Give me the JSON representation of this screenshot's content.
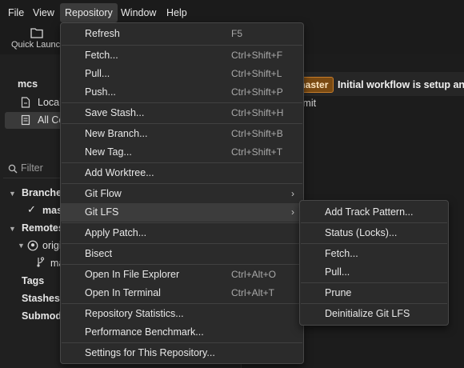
{
  "menubar": {
    "items": [
      "File",
      "View",
      "Repository",
      "Window",
      "Help"
    ]
  },
  "toolbar": {
    "quick_launch": "Quick Launch"
  },
  "sidebar": {
    "repo_name": "mcs",
    "local_changes": "Local Changes",
    "all_commits": "All Commits",
    "filter_placeholder": "Filter",
    "branches": "Branches",
    "master": "master",
    "remotes": "Remotes",
    "origin": "origin",
    "origin_master": "master",
    "tags": "Tags",
    "stashes": "Stashes",
    "submodules": "Submodules"
  },
  "commit": {
    "badge": "master",
    "title": "Initial workflow is setup and",
    "subtitle": "mmit"
  },
  "menu": {
    "items": [
      {
        "label": "Refresh",
        "shortcut": "F5"
      },
      {
        "label": "Fetch...",
        "shortcut": "Ctrl+Shift+F"
      },
      {
        "label": "Pull...",
        "shortcut": "Ctrl+Shift+L"
      },
      {
        "label": "Push...",
        "shortcut": "Ctrl+Shift+P"
      },
      {
        "label": "Save Stash...",
        "shortcut": "Ctrl+Shift+H"
      },
      {
        "label": "New Branch...",
        "shortcut": "Ctrl+Shift+B"
      },
      {
        "label": "New Tag...",
        "shortcut": "Ctrl+Shift+T"
      },
      {
        "label": "Add Worktree...",
        "shortcut": ""
      },
      {
        "label": "Git Flow",
        "shortcut": ""
      },
      {
        "label": "Git LFS",
        "shortcut": ""
      },
      {
        "label": "Apply Patch...",
        "shortcut": ""
      },
      {
        "label": "Bisect",
        "shortcut": ""
      },
      {
        "label": "Open In File Explorer",
        "shortcut": "Ctrl+Alt+O"
      },
      {
        "label": "Open In Terminal",
        "shortcut": "Ctrl+Alt+T"
      },
      {
        "label": "Repository Statistics...",
        "shortcut": ""
      },
      {
        "label": "Performance Benchmark...",
        "shortcut": ""
      },
      {
        "label": "Settings for This Repository...",
        "shortcut": ""
      }
    ]
  },
  "submenu": {
    "items": [
      {
        "label": "Add Track Pattern..."
      },
      {
        "label": "Status (Locks)..."
      },
      {
        "label": "Fetch..."
      },
      {
        "label": "Pull..."
      },
      {
        "label": "Prune"
      },
      {
        "label": "Deinitialize Git LFS"
      }
    ]
  },
  "colors": {
    "accent_badge": "#7a4a12",
    "badge_border": "#c77d2a",
    "menu_bg": "#2b2b2b",
    "highlight": "#3c3c3c"
  }
}
